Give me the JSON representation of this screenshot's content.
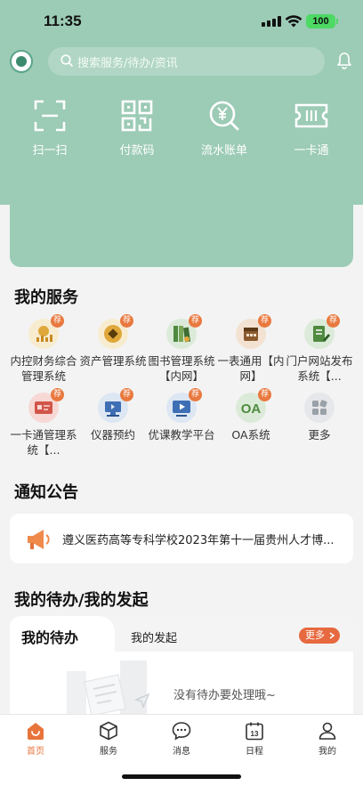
{
  "status": {
    "time": "11:35",
    "battery": "100"
  },
  "search": {
    "placeholder": "搜索服务/待办/资讯"
  },
  "quick_actions": [
    {
      "label": "扫一扫",
      "icon": "scan-icon"
    },
    {
      "label": "付款码",
      "icon": "qr-code-icon"
    },
    {
      "label": "流水账单",
      "icon": "yuan-search-icon"
    },
    {
      "label": "一卡通",
      "icon": "card-icon"
    }
  ],
  "services": {
    "title": "我的服务",
    "badge": "荐",
    "items": [
      {
        "label": "内控财务综合管理系统",
        "icon": "finance-icon"
      },
      {
        "label": "资产管理系统",
        "icon": "asset-icon"
      },
      {
        "label": "图书管理系统【内网】",
        "icon": "books-icon"
      },
      {
        "label": "一表通用【内网】",
        "icon": "calendar-form-icon"
      },
      {
        "label": "门户网站发布系统【...",
        "icon": "document-edit-icon"
      },
      {
        "label": "一卡通管理系统【...",
        "icon": "id-card-icon"
      },
      {
        "label": "仪器预约",
        "icon": "instrument-icon"
      },
      {
        "label": "优课教学平台",
        "icon": "video-lesson-icon"
      },
      {
        "label": "OA系统",
        "icon": "oa-icon"
      },
      {
        "label": "更多",
        "icon": "grid-more-icon"
      }
    ]
  },
  "notice": {
    "title": "通知公告",
    "text": "遵义医药高等专科学校2023年第十一届贵州人才博..."
  },
  "todo": {
    "title": "我的待办/我的发起",
    "tab_active": "我的待办",
    "tab_other": "我的发起",
    "more": "更多",
    "empty": "没有待办要处理哦~"
  },
  "tabbar": [
    {
      "label": "首页",
      "icon": "home-icon",
      "active": true
    },
    {
      "label": "服务",
      "icon": "cube-icon",
      "active": false
    },
    {
      "label": "消息",
      "icon": "message-icon",
      "active": false
    },
    {
      "label": "日程",
      "icon": "calendar-icon",
      "active": false
    },
    {
      "label": "我的",
      "icon": "user-icon",
      "active": false
    }
  ],
  "colors": {
    "header": "#9ccbb6",
    "accent": "#e8743b"
  }
}
